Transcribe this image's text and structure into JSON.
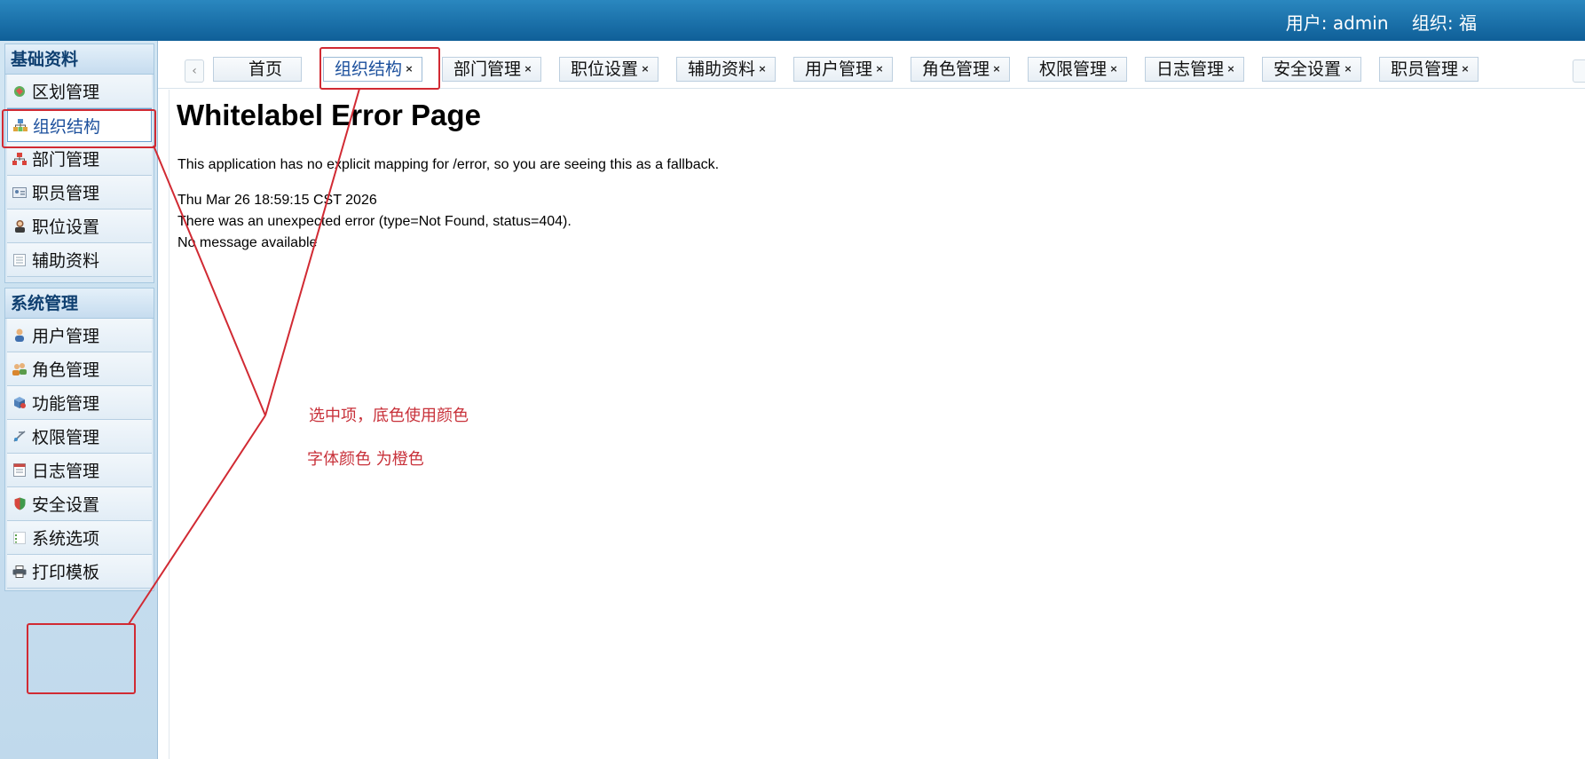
{
  "header": {
    "user_text": "用户: admin",
    "org_text": "组织: 福"
  },
  "sidebar": {
    "groups": [
      {
        "title": "基础资料",
        "items": [
          {
            "label": "区划管理",
            "icon": "region-icon"
          },
          {
            "label": "组织结构",
            "icon": "org-structure-icon",
            "active": true
          },
          {
            "label": "部门管理",
            "icon": "department-icon"
          },
          {
            "label": "职员管理",
            "icon": "employee-card-icon"
          },
          {
            "label": "职位设置",
            "icon": "position-icon"
          },
          {
            "label": "辅助资料",
            "icon": "list-doc-icon"
          }
        ]
      },
      {
        "title": "系统管理",
        "items": [
          {
            "label": "用户管理",
            "icon": "user-icon"
          },
          {
            "label": "角色管理",
            "icon": "role-icon"
          },
          {
            "label": "功能管理",
            "icon": "function-icon"
          },
          {
            "label": "权限管理",
            "icon": "permission-icon"
          },
          {
            "label": "日志管理",
            "icon": "log-icon"
          },
          {
            "label": "安全设置",
            "icon": "shield-icon"
          },
          {
            "label": "系统选项",
            "icon": "options-icon"
          },
          {
            "label": "打印模板",
            "icon": "printer-icon"
          }
        ]
      }
    ]
  },
  "tabs": {
    "prev_glyph": "‹",
    "close_glyph": "×",
    "items": [
      {
        "label": "首页",
        "closable": false
      },
      {
        "label": "组织结构",
        "closable": true,
        "active": true
      },
      {
        "label": "部门管理",
        "closable": true
      },
      {
        "label": "职位设置",
        "closable": true
      },
      {
        "label": "辅助资料",
        "closable": true
      },
      {
        "label": "用户管理",
        "closable": true
      },
      {
        "label": "角色管理",
        "closable": true
      },
      {
        "label": "权限管理",
        "closable": true
      },
      {
        "label": "日志管理",
        "closable": true
      },
      {
        "label": "安全设置",
        "closable": true
      },
      {
        "label": "职员管理",
        "closable": true
      }
    ]
  },
  "content": {
    "title": "Whitelabel Error Page",
    "message": "This application has no explicit mapping for /error, so you are seeing this as a fallback.",
    "timestamp": "Thu Mar 26 18:59:15 CST 2026",
    "error_detail": "There was an unexpected error (type=Not Found, status=404).",
    "no_message": "No message available"
  },
  "annotations": {
    "note_1": "选中项，底色使用颜色",
    "note_2": "字体颜色 为橙色"
  },
  "colors": {
    "header_bar": "#1a6fa9",
    "sidebar_bg": "#c8dff0",
    "active_text": "#1b4f9c",
    "annotation_red": "#c8313a"
  }
}
